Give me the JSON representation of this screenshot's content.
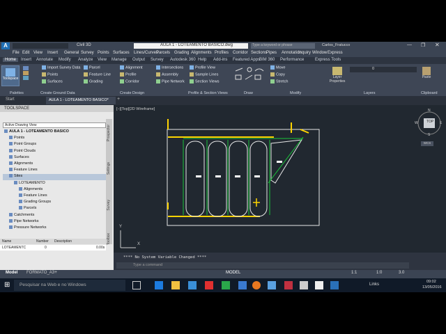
{
  "window": {
    "qat_title": "Civil 3D",
    "doc_title": "AULA 1 - LOTEAMENTO BASICO.dwg",
    "search_placeholder": "Type a keyword or phrase",
    "user": "Carlos_Fratucco"
  },
  "menu": [
    "File",
    "Edit",
    "View",
    "Insert",
    "General",
    "Survey",
    "Points",
    "Surfaces",
    "Lines/Curves",
    "Parcels",
    "Grading",
    "Alignments",
    "Profiles",
    "Corridor",
    "Sections",
    "Pipes",
    "Annotation",
    "Inquiry",
    "Window",
    "Express"
  ],
  "ribbon_tabs": [
    "Home",
    "Insert",
    "Annotate",
    "Modify",
    "Analyze",
    "View",
    "Manage",
    "Output",
    "Survey",
    "Autodesk 360",
    "Help",
    "Add-ins",
    "Featured Apps",
    "BIM 360",
    "Performance",
    "Express Tools"
  ],
  "ribbon": {
    "toolspace": "Toolspace",
    "palettes": "Palettes",
    "create_ground_data": [
      "Import Survey Data",
      "Points",
      "Surfaces"
    ],
    "create_ground_label": "Create Ground Data",
    "create_design": [
      "Parcel",
      "Feature Line",
      "Grading",
      "Alignment",
      "Profile",
      "Corridor",
      "Intersections",
      "Assembly",
      "Pipe Network"
    ],
    "create_design_label": "Create Design",
    "profile_section": [
      "Profile View",
      "Sample Lines",
      "Section Views"
    ],
    "profile_section_label": "Profile & Section Views",
    "draw_label": "Draw",
    "modify": [
      "Move",
      "Copy",
      "Stretch"
    ],
    "modify_label": "Modify",
    "layers_label": "Layers",
    "layer_properties": "Layer Properties",
    "layer_value": "0",
    "paste": "Paste",
    "clipboard_label": "Clipboard"
  },
  "doc_tabs": [
    "Start",
    "AULA 1 - LOTEAMENTO BASICO*"
  ],
  "toolspace": {
    "title": "TOOLSPACE",
    "view_select": "Active Drawing View",
    "tree": [
      {
        "label": "AULA 1 - LOTEAMENTO BASICO",
        "indent": 0,
        "bold": true
      },
      {
        "label": "Points",
        "indent": 1
      },
      {
        "label": "Point Groups",
        "indent": 1
      },
      {
        "label": "Point Clouds",
        "indent": 1
      },
      {
        "label": "Surfaces",
        "indent": 1
      },
      {
        "label": "Alignments",
        "indent": 1
      },
      {
        "label": "Feature Lines",
        "indent": 1
      },
      {
        "label": "Sites",
        "indent": 1,
        "selected": true
      },
      {
        "label": "LOTEAMENTO",
        "indent": 2
      },
      {
        "label": "Alignments",
        "indent": 3
      },
      {
        "label": "Feature Lines",
        "indent": 3
      },
      {
        "label": "Grading Groups",
        "indent": 3
      },
      {
        "label": "Parcels",
        "indent": 3
      },
      {
        "label": "Catchments",
        "indent": 1
      },
      {
        "label": "Pipe Networks",
        "indent": 1
      },
      {
        "label": "Pressure Networks",
        "indent": 1
      }
    ],
    "side_tabs": [
      "Prospector",
      "Settings",
      "Survey",
      "Toolbox"
    ],
    "table_headers": [
      "Name",
      "Number",
      "Description"
    ],
    "table_rows": [
      {
        "name": "LOTEAMENTC",
        "number": "0",
        "extra": "0.00s"
      }
    ]
  },
  "canvas": {
    "viewport_label": "[−][Top][2D Wireframe]",
    "viewcube_top": "TOP",
    "compass": [
      "N",
      "W",
      "E",
      "S"
    ],
    "wcs": "WCS",
    "ucs_y": "Y",
    "ucs_x": "X"
  },
  "command": {
    "history": "**** No System Variable Changed ****",
    "placeholder": "Type a command"
  },
  "layout_tabs": [
    "Model",
    "FORMATO_A3"
  ],
  "status": {
    "model": "MODEL",
    "scale": "1:1",
    "scale2": "1:0",
    "annot": "3.0"
  },
  "taskbar": {
    "search": "Pesquisar na Web e no Windows",
    "links": "Links",
    "time": "09:02",
    "date": "13/05/2016"
  },
  "colors": {
    "canvas_bg": "#212830",
    "parcel_line": "#e8e8e8",
    "lot_boundary": "#ffd400",
    "lot_green": "#19c43a"
  }
}
